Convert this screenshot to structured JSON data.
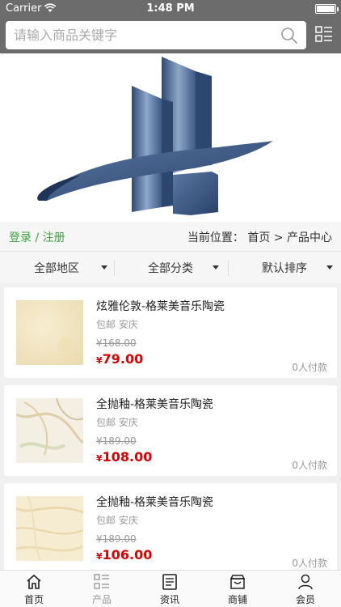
{
  "status_bar": {
    "carrier": "Carrier",
    "time": "1:48 PM"
  },
  "search": {
    "placeholder": "请输入商品关键字"
  },
  "breadcrumb": {
    "login": "登录 / 注册",
    "location": "当前位置：  首页 > 产品中心"
  },
  "filters": [
    "全部地区",
    "全部分类",
    "默认排序"
  ],
  "products": [
    {
      "title": "炫雅伦敦-格莱美音乐陶瓷",
      "shipping": "包邮",
      "city": "安庆",
      "original_price": "¥168.00",
      "currency": "¥",
      "price": "79.00",
      "paid": "0人付款"
    },
    {
      "title": "全抛釉-格莱美音乐陶瓷",
      "shipping": "包邮",
      "city": "安庆",
      "original_price": "¥189.00",
      "currency": "¥",
      "price": "108.00",
      "paid": "0人付款"
    },
    {
      "title": "全抛釉-格莱美音乐陶瓷",
      "shipping": "包邮",
      "city": "安庆",
      "original_price": "¥189.00",
      "currency": "¥",
      "price": "106.00",
      "paid": "0人付款"
    }
  ],
  "tabs": [
    {
      "label": "首页",
      "icon": "home-icon"
    },
    {
      "label": "产品",
      "icon": "grid-list-icon",
      "active": true
    },
    {
      "label": "资讯",
      "icon": "news-icon"
    },
    {
      "label": "商铺",
      "icon": "shop-icon"
    },
    {
      "label": "会员",
      "icon": "user-icon"
    }
  ],
  "colors": {
    "header_bg": "#6c6c6c",
    "login_green": "#3aa23a",
    "price_red": "#dd0000",
    "logo_blue": "#3f5f8c"
  }
}
